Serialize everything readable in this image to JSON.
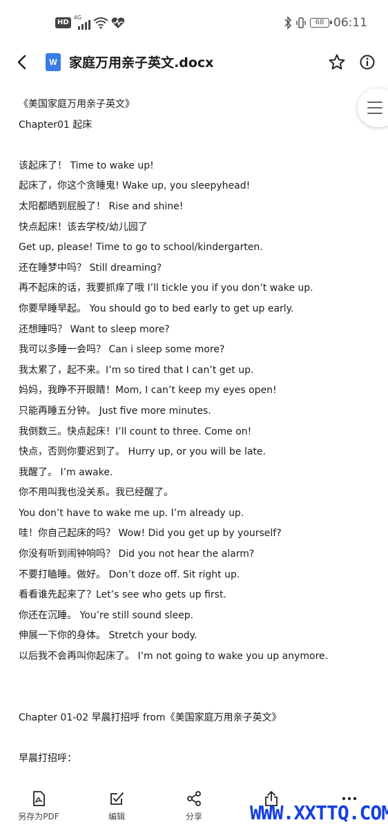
{
  "status_bar": {
    "hd_badge": "HD",
    "network": "4G",
    "battery": "68",
    "time": "06:11"
  },
  "header": {
    "doc_icon_letter": "W",
    "title": "家庭万用亲子英文.docx"
  },
  "document": {
    "lines": [
      "《美国家庭万用亲子英文》",
      "Chapter01 起床",
      "",
      "该起床了！ Time to wake up!",
      "起床了，你这个贪睡鬼! Wake up, you sleepyhead!",
      "太阳都晒到屁股了！ Rise and shine!",
      "快点起床！该去学校/幼儿园了",
      "Get up, please! Time to go to school/kindergarten.",
      "还在睡梦中吗？ Still dreaming?",
      "再不起床的话，我要抓痒了哦 I’ll tickle you if you don’t wake up.",
      "你要早睡早起。 You should go to bed early to get up early.",
      "还想睡吗？ Want to sleep more?",
      "我可以多睡一会吗？ Can i sleep some more?",
      "我太累了，起不来。I’m so tired that I can’t get up.",
      "妈妈，我睁不开眼睛！Mom, I can’t keep my eyes open!",
      "只能再睡五分钟。 Just five more minutes.",
      "我倒数三。快点起床！I’ll count to three. Come on!",
      "快点，否则你要迟到了。 Hurry up, or you will be late.",
      "我醒了。 I’m awake.",
      "你不用叫我也没关系。我已经醒了。",
      "You don’t have to wake me up. I’m already up.",
      "哇！你自己起床的吗？ Wow! Did you get up by yourself?",
      "你没有听到闹钟响吗？ Did you not hear the alarm?",
      "不要打瞌睡。做好。 Don’t doze off. Sit right up.",
      "看看谁先起来了？Let’s see who gets up first.",
      "你还在沉睡。 You’re still sound sleep.",
      "伸展一下你的身体。 Stretch your body.",
      "以后我不会再叫你起床了。 I’m not going to wake you up anymore.",
      "",
      "",
      "Chapter 01-02 早晨打招呼 from《美国家庭万用亲子英文》",
      "",
      "早晨打招呼："
    ]
  },
  "bottom_bar": {
    "items": [
      {
        "label": "另存为PDF",
        "icon": "pdf-icon"
      },
      {
        "label": "编辑",
        "icon": "edit-icon"
      },
      {
        "label": "分享",
        "icon": "share-icon"
      },
      {
        "label": "",
        "icon": "export-icon"
      },
      {
        "label": "",
        "icon": "more-icon"
      }
    ]
  },
  "watermark": "WWW.XXTTQ.COM",
  "colors": {
    "accent": "#3b7ce6",
    "watermark": "#1540e0",
    "text": "#1a1a1a"
  }
}
